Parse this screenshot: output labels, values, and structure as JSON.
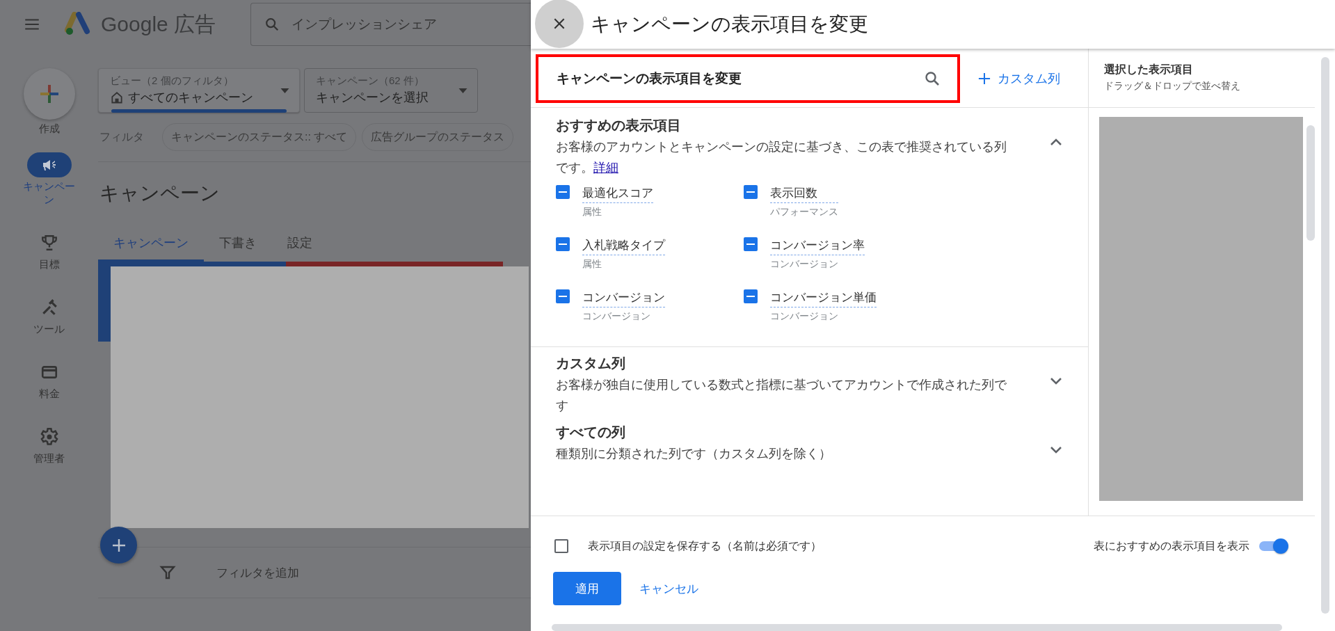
{
  "app": {
    "product": "Google 広告",
    "search": {
      "placeholder": "インプレッションシェア"
    }
  },
  "sidebar": {
    "create_label": "作成",
    "items": [
      {
        "label": "キャンペーン",
        "selected": true
      },
      {
        "label": "目標",
        "selected": false
      },
      {
        "label": "ツール",
        "selected": false
      },
      {
        "label": "料金",
        "selected": false
      },
      {
        "label": "管理者",
        "selected": false
      }
    ]
  },
  "selectors": [
    {
      "kind": "view",
      "caption": "ビュー（2 個のフィルタ）",
      "value": "すべてのキャンペーン"
    },
    {
      "kind": "plain",
      "caption": "キャンペーン（62 件）",
      "value": "キャンペーンを選択"
    }
  ],
  "filters": {
    "label": "フィルタ",
    "chips": [
      "キャンペーンのステータス:: すべて",
      "広告グループのステータス"
    ]
  },
  "page_title": "キャンペーン",
  "tabs": [
    {
      "label": "キャンペーン",
      "selected": true
    },
    {
      "label": "下書き",
      "selected": false
    },
    {
      "label": "設定",
      "selected": false
    }
  ],
  "add_filter": "フィルタを追加",
  "panel": {
    "title": "キャンペーンの表示項目を変更",
    "search": {
      "value": "キャンペーンの表示項目を変更"
    },
    "custom_column_button": "カスタム列",
    "sections": [
      {
        "title": "おすすめの表示項目",
        "description": "お客様のアカウントとキャンペーンの設定に基づき、この表で推奨されている列です。",
        "link": "詳細",
        "expanded": true,
        "columns": [
          {
            "name": "最適化スコア",
            "category": "属性",
            "checked": true
          },
          {
            "name": "表示回数",
            "category": "パフォーマンス",
            "checked": true
          },
          {
            "name": "入札戦略タイプ",
            "category": "属性",
            "checked": true
          },
          {
            "name": "コンバージョン率",
            "category": "コンバージョン",
            "checked": true
          },
          {
            "name": "コンバージョン",
            "category": "コンバージョン",
            "checked": true
          },
          {
            "name": "コンバージョン単価",
            "category": "コンバージョン",
            "checked": true
          }
        ]
      },
      {
        "title": "カスタム列",
        "description": "お客様が独自に使用している数式と指標に基づいてアカウントで作成された列です",
        "expanded": false
      },
      {
        "title": "すべての列",
        "description": "種類別に分類された列です（カスタム列を除く）",
        "expanded": false
      }
    ],
    "selected_columns": {
      "title": "選択した表示項目",
      "subtitle": "ドラッグ＆ドロップで並べ替え"
    },
    "save_settings": {
      "label": "表示項目の設定を保存する（名前は必須です）",
      "checked": false
    },
    "show_recommended": {
      "label": "表におすすめの表示項目を表示",
      "on": true
    },
    "apply_button": "適用",
    "cancel_button": "キャンセル"
  }
}
